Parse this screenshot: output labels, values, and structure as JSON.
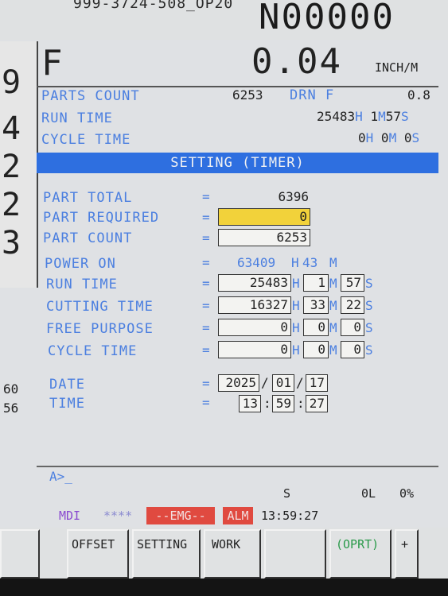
{
  "header": {
    "program_id": "999-3724-508_OP20",
    "program_number": "N00000"
  },
  "feed": {
    "label": "F",
    "value": "0.04",
    "unit": "INCH/M"
  },
  "left_panel": {
    "digits": [
      "9",
      "4",
      "2",
      "2",
      "3"
    ],
    "numbers": [
      "60",
      "56"
    ]
  },
  "status": {
    "parts_count_label": "PARTS COUNT",
    "parts_count_value": "6253",
    "drn_label": "DRN F",
    "drn_value": "0.8",
    "run_time_label": "RUN TIME",
    "run_time_h": "25483",
    "run_time_m": "1",
    "run_time_s": "57",
    "cycle_time_label": "CYCLE TIME",
    "cycle_time_h": "0",
    "cycle_time_m": "0",
    "cycle_time_s": "0",
    "unit_h": "H",
    "unit_m": "M",
    "unit_s": "S"
  },
  "screen_title": "SETTING (TIMER)",
  "setting": {
    "part_total_label": "PART TOTAL",
    "part_total_value": "6396",
    "part_required_label": "PART REQUIRED",
    "part_required_value": "0",
    "part_count_label": "PART COUNT",
    "part_count_value": "6253",
    "power_on_label": "POWER ON",
    "power_on_h": "63409",
    "power_on_m": "43",
    "run_time_label": "RUN TIME",
    "run_time_h": "25483",
    "run_time_m": "1",
    "run_time_s": "57",
    "cutting_time_label": "CUTTING TIME",
    "cutting_time_h": "16327",
    "cutting_time_m": "33",
    "cutting_time_s": "22",
    "free_purpose_label": "FREE PURPOSE",
    "free_purpose_h": "0",
    "free_purpose_m": "0",
    "free_purpose_s": "0",
    "cycle_time_label": "CYCLE TIME",
    "cycle_time_h": "0",
    "cycle_time_m": "0",
    "cycle_time_s": "0",
    "date_label": "DATE",
    "date_year": "2025",
    "date_month": "01",
    "date_day": "17",
    "date_sep": "/",
    "time_label": "TIME",
    "time_h": "13",
    "time_m": "59",
    "time_s": "27",
    "time_sep": ":",
    "eq": "="
  },
  "input_prompt": "A>_",
  "status_line": {
    "s": "S",
    "ol": "0L",
    "pct": "0%"
  },
  "mode_bar": {
    "mode": "MDI",
    "stars": "****",
    "emg": "--EMG--",
    "alm": "ALM",
    "clock": "13:59:27"
  },
  "softkeys": [
    "OFFSET",
    "SETTING",
    "WORK",
    "",
    "(OPRT)",
    "+"
  ],
  "colors": {
    "label_blue": "#4b7fe0",
    "header_blue": "#2e6fe0",
    "cursor_yellow": "#f2d23a",
    "alarm_red": "#e04a40",
    "mode_purple": "#8a4bd0",
    "oprt_green": "#2a9a4a"
  }
}
